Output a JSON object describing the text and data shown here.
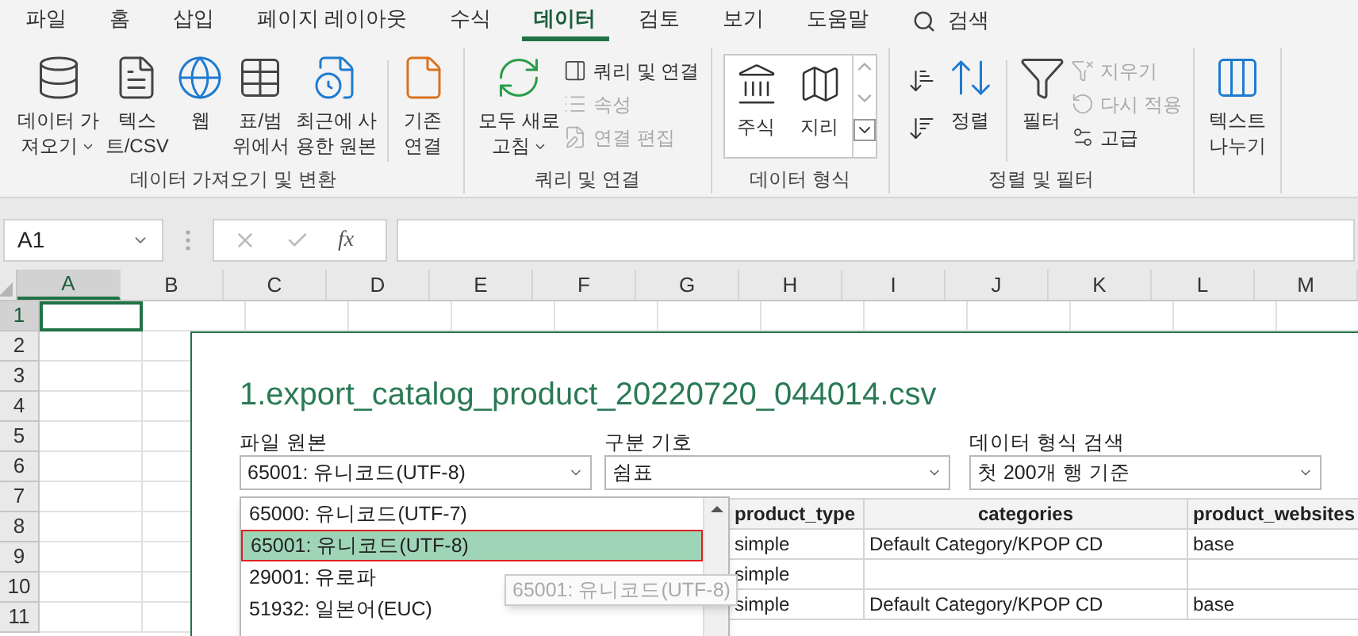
{
  "menu_tabs": [
    {
      "label": "파일",
      "selected": false
    },
    {
      "label": "홈",
      "selected": false
    },
    {
      "label": "삽입",
      "selected": false
    },
    {
      "label": "페이지 레이아웃",
      "selected": false
    },
    {
      "label": "수식",
      "selected": false
    },
    {
      "label": "데이터",
      "selected": true
    },
    {
      "label": "검토",
      "selected": false
    },
    {
      "label": "보기",
      "selected": false
    },
    {
      "label": "도움말",
      "selected": false
    }
  ],
  "search": {
    "label": "검색"
  },
  "ribbon_groups": [
    {
      "label": "데이터 가져오기 및 변환",
      "commands": [
        {
          "kind": "large",
          "lines": [
            "데이터 가",
            "져오기"
          ],
          "has_menu": true
        },
        {
          "kind": "large",
          "lines": [
            "텍스",
            "트/CSV"
          ],
          "has_menu": false
        },
        {
          "kind": "large",
          "lines": [
            "웹"
          ],
          "has_menu": false
        },
        {
          "kind": "large",
          "lines": [
            "표/범",
            "위에서"
          ],
          "has_menu": false
        },
        {
          "kind": "large",
          "lines": [
            "최근에 사",
            "용한 원본"
          ],
          "has_menu": false
        },
        {
          "kind": "separator"
        },
        {
          "kind": "large",
          "lines": [
            "기존",
            "연결"
          ],
          "has_menu": false
        }
      ]
    },
    {
      "label": "쿼리 및 연결",
      "commands": [
        {
          "kind": "large",
          "lines": [
            "모두 새로",
            "고침"
          ],
          "has_menu": true
        },
        {
          "kind": "small",
          "label": "쿼리 및 연결",
          "disabled": false
        },
        {
          "kind": "small",
          "label": "속성",
          "disabled": true
        },
        {
          "kind": "small",
          "label": "연결 편집",
          "disabled": true
        }
      ]
    },
    {
      "label": "데이터 형식",
      "commands": [
        {
          "kind": "gallery",
          "items": [
            "주식",
            "지리"
          ]
        }
      ]
    },
    {
      "label": "정렬 및 필터",
      "commands": [
        {
          "kind": "sortpair"
        },
        {
          "kind": "large",
          "lines": [
            "정렬"
          ],
          "has_menu": false
        },
        {
          "kind": "separator"
        },
        {
          "kind": "large",
          "lines": [
            "필터"
          ],
          "has_menu": false
        },
        {
          "kind": "small",
          "label": "지우기",
          "disabled": true
        },
        {
          "kind": "small",
          "label": "다시 적용",
          "disabled": true
        },
        {
          "kind": "small",
          "label": "고급",
          "disabled": false
        }
      ]
    },
    {
      "commands": [
        {
          "kind": "large",
          "lines": [
            "텍스트",
            "나누기"
          ],
          "has_menu": false
        }
      ]
    }
  ],
  "name_box": {
    "value": "A1"
  },
  "formula_bar": {
    "function_label": "fx"
  },
  "sheet": {
    "columns": [
      {
        "label": "A",
        "selected": true
      },
      {
        "label": "B",
        "selected": false
      },
      {
        "label": "C",
        "selected": false
      },
      {
        "label": "D",
        "selected": false
      },
      {
        "label": "E",
        "selected": false
      },
      {
        "label": "F",
        "selected": false
      },
      {
        "label": "G",
        "selected": false
      },
      {
        "label": "H",
        "selected": false
      },
      {
        "label": "I",
        "selected": false
      },
      {
        "label": "J",
        "selected": false
      },
      {
        "label": "K",
        "selected": false
      },
      {
        "label": "L",
        "selected": false
      },
      {
        "label": "M",
        "selected": false
      }
    ],
    "rows": [
      {
        "label": "1",
        "selected": true
      },
      {
        "label": "2",
        "selected": false
      },
      {
        "label": "3",
        "selected": false
      },
      {
        "label": "4",
        "selected": false
      },
      {
        "label": "5",
        "selected": false
      },
      {
        "label": "6",
        "selected": false
      },
      {
        "label": "7",
        "selected": false
      },
      {
        "label": "8",
        "selected": false
      },
      {
        "label": "9",
        "selected": false
      },
      {
        "label": "10",
        "selected": false
      },
      {
        "label": "11",
        "selected": false
      }
    ]
  },
  "import_dialog": {
    "title": "1.export_catalog_product_20220720_044014.csv",
    "fields": [
      {
        "label": "파일 원본",
        "value": "65001: 유니코드(UTF-8)"
      },
      {
        "label": "구분 기호",
        "value": "쉼표"
      },
      {
        "label": "데이터 형식 검색",
        "value": "첫 200개 행 기준"
      }
    ],
    "encoding_options": [
      {
        "label": "65000: 유니코드(UTF-7)",
        "selected": false
      },
      {
        "label": "65001: 유니코드(UTF-8)",
        "selected": true
      },
      {
        "label": "29001: 유로파",
        "selected": false
      },
      {
        "label": "51932: 일본어(EUC)",
        "selected": false
      }
    ],
    "tooltip": "65001: 유니코드(UTF-8)",
    "preview": {
      "columns": [
        "product_type",
        "categories",
        "product_websites"
      ],
      "rows": [
        [
          "simple",
          "Default Category/KPOP CD",
          "base"
        ],
        [
          "simple",
          "",
          ""
        ],
        [
          "simple",
          "Default Category/KPOP CD",
          "base"
        ]
      ]
    }
  }
}
